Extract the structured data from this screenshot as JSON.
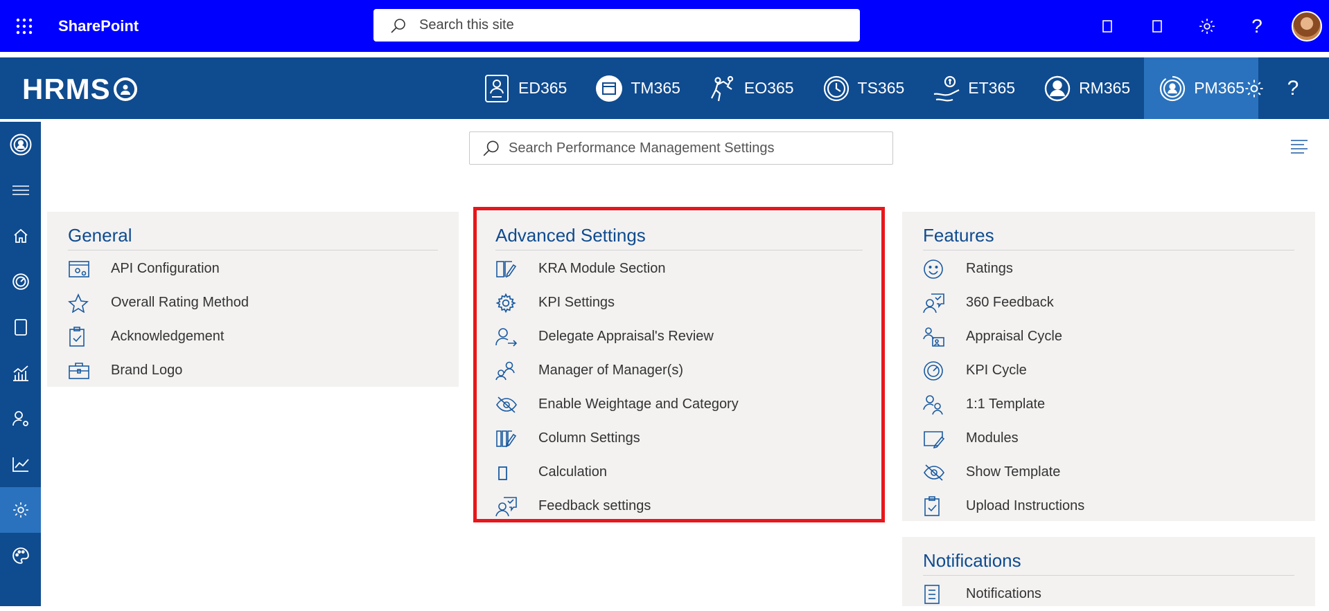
{
  "suite": {
    "app_name": "SharePoint",
    "search_placeholder": "Search this site"
  },
  "hrms": {
    "logo_text": "HRMS",
    "apps": [
      {
        "label": "ED365",
        "icon": "ed365-icon"
      },
      {
        "label": "TM365",
        "icon": "tm365-icon"
      },
      {
        "label": "EO365",
        "icon": "eo365-icon"
      },
      {
        "label": "TS365",
        "icon": "ts365-icon"
      },
      {
        "label": "ET365",
        "icon": "et365-icon"
      },
      {
        "label": "RM365",
        "icon": "rm365-icon"
      },
      {
        "label": "PM365",
        "icon": "pm365-icon",
        "active": true
      }
    ]
  },
  "search": {
    "placeholder": "Search Performance Management Settings"
  },
  "sections": {
    "general": {
      "title": "General",
      "items": [
        "API Configuration",
        "Overall Rating Method",
        "Acknowledgement",
        "Brand Logo"
      ]
    },
    "advanced": {
      "title": "Advanced Settings",
      "items": [
        "KRA Module Section",
        "KPI Settings",
        "Delegate Appraisal's Review",
        "Manager of Manager(s)",
        "Enable Weightage and Category",
        "Column Settings",
        "Calculation",
        "Feedback settings"
      ]
    },
    "features": {
      "title": "Features",
      "items": [
        "Ratings",
        "360 Feedback",
        "Appraisal Cycle",
        "KPI Cycle",
        "1:1 Template",
        "Modules",
        "Show Template",
        "Upload Instructions"
      ]
    },
    "notifications": {
      "title": "Notifications",
      "items": [
        "Notifications"
      ]
    }
  },
  "colors": {
    "suite_bar": "#0000ff",
    "hrms_bar": "#0f4b8f",
    "active_tab": "#2a72bd",
    "card_bg": "#f3f2f1",
    "highlight_border": "#e8161b"
  }
}
